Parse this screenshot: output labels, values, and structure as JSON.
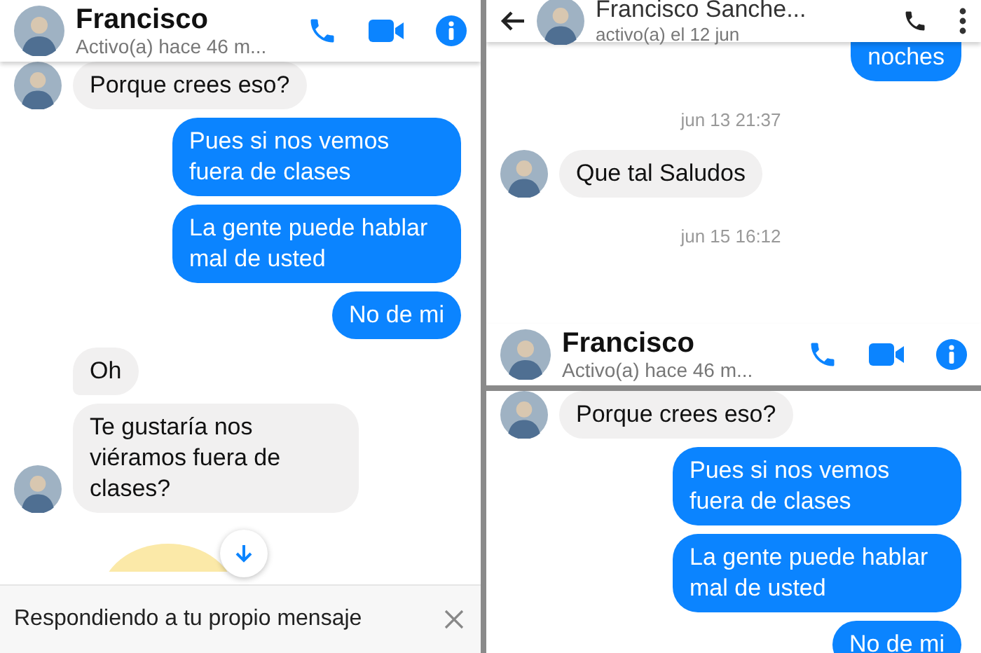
{
  "panels": [
    {
      "header": {
        "back": false,
        "name": "Francisco",
        "status": "Activo(a) hace 46 m...",
        "actions": [
          {
            "kind": "phone"
          },
          {
            "kind": "video"
          },
          {
            "kind": "info"
          }
        ]
      },
      "messages": [
        {
          "kind": "incoming",
          "text": "Porque crees eso?",
          "avatar": true
        },
        {
          "kind": "outgoing",
          "text": "Pues si nos vemos fuera de clases"
        },
        {
          "kind": "outgoing",
          "text": "La gente puede hablar mal de usted"
        },
        {
          "kind": "outgoing",
          "text": "No de mi"
        },
        {
          "kind": "incoming",
          "text": "Oh",
          "avatar": false
        },
        {
          "kind": "incoming",
          "text": "Te gustaría nos viéramos fuera de clases?",
          "avatar": true
        },
        {
          "kind": "sticker"
        }
      ],
      "scroll_down": true,
      "reply_bar": {
        "text": "Respondiendo a tu propio mensaje"
      }
    },
    {
      "header": {
        "back": true,
        "name": "Francisco Sanche...",
        "status": "activo(a) el 12 jun",
        "actions": [
          {
            "kind": "phone-dark"
          },
          {
            "kind": "more"
          }
        ]
      },
      "messages": [
        {
          "kind": "outgoing",
          "text": "noches",
          "clipped": true
        },
        {
          "kind": "timestamp",
          "text": "jun 13 21:37"
        },
        {
          "kind": "incoming",
          "text": "Que tal Saludos",
          "avatar": true
        },
        {
          "kind": "timestamp",
          "text": "jun 15 16:12"
        }
      ],
      "footer_header": {
        "back": false,
        "name": "Francisco",
        "status": "Activo(a) hace 46 m...",
        "actions": [
          {
            "kind": "phone"
          },
          {
            "kind": "video"
          },
          {
            "kind": "info"
          }
        ]
      }
    },
    {
      "messages": [
        {
          "kind": "incoming",
          "text": "Porque crees eso?",
          "avatar": true
        },
        {
          "kind": "outgoing",
          "text": "Pues si nos vemos fuera de clases"
        },
        {
          "kind": "outgoing",
          "text": "La gente puede hablar mal de usted"
        },
        {
          "kind": "outgoing",
          "text": "No de mi"
        }
      ]
    }
  ]
}
